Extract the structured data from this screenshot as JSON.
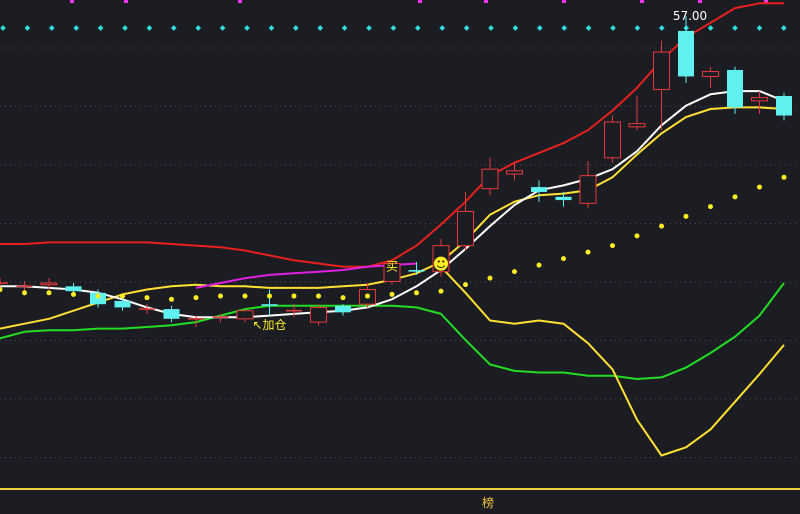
{
  "chart_data": {
    "type": "line",
    "subtype": "candlestick-with-indicators",
    "x_count": 33,
    "ylim": [
      28,
      58
    ],
    "grid": true,
    "legend": "none",
    "colors": {
      "background": "#1b1d22",
      "up_candle": "#e8393a",
      "down_candle": "#5ff0f0",
      "red_line": "#e8201e",
      "white_line": "#ffffff",
      "yellow_line": "#ffe033",
      "magenta_line": "#e020e0",
      "green_line": "#22dd22",
      "dots": "#ffee22",
      "cyan_dots": "#33dddd",
      "magenta_dots": "#ff33ff"
    },
    "candles": [
      {
        "o": 40.6,
        "c": 40.5,
        "h": 40.9,
        "l": 40.1,
        "d": "doji"
      },
      {
        "o": 40.4,
        "c": 40.4,
        "h": 40.7,
        "l": 40.1,
        "d": "doji"
      },
      {
        "o": 40.5,
        "c": 40.6,
        "h": 40.9,
        "l": 40.2,
        "d": "up"
      },
      {
        "o": 40.4,
        "c": 40.1,
        "h": 40.6,
        "l": 39.9,
        "d": "down"
      },
      {
        "o": 40.0,
        "c": 39.3,
        "h": 40.2,
        "l": 39.1,
        "d": "down"
      },
      {
        "o": 39.5,
        "c": 39.1,
        "h": 39.8,
        "l": 38.9,
        "d": "down"
      },
      {
        "o": 39.0,
        "c": 39.0,
        "h": 39.3,
        "l": 38.7,
        "d": "doji"
      },
      {
        "o": 39.0,
        "c": 38.4,
        "h": 39.2,
        "l": 38.2,
        "d": "down"
      },
      {
        "o": 38.4,
        "c": 38.4,
        "h": 38.6,
        "l": 37.9,
        "d": "doji"
      },
      {
        "o": 38.5,
        "c": 38.5,
        "h": 38.7,
        "l": 38.2,
        "d": "doji"
      },
      {
        "o": 38.4,
        "c": 38.9,
        "h": 39.0,
        "l": 38.2,
        "d": "up"
      },
      {
        "o": 39.2,
        "c": 39.3,
        "h": 40.2,
        "l": 38.6,
        "d": "down"
      },
      {
        "o": 38.9,
        "c": 38.9,
        "h": 39.3,
        "l": 38.5,
        "d": "doji"
      },
      {
        "o": 38.2,
        "c": 39.1,
        "h": 39.3,
        "l": 38.0,
        "d": "up"
      },
      {
        "o": 39.2,
        "c": 38.8,
        "h": 39.3,
        "l": 38.6,
        "d": "down"
      },
      {
        "o": 39.3,
        "c": 40.2,
        "h": 40.6,
        "l": 39.1,
        "d": "up"
      },
      {
        "o": 40.7,
        "c": 41.8,
        "h": 41.9,
        "l": 40.5,
        "d": "up"
      },
      {
        "o": 41.3,
        "c": 41.4,
        "h": 41.9,
        "l": 41.1,
        "d": "down"
      },
      {
        "o": 41.3,
        "c": 42.9,
        "h": 43.3,
        "l": 41.0,
        "d": "up"
      },
      {
        "o": 42.9,
        "c": 45.0,
        "h": 46.2,
        "l": 42.6,
        "d": "up"
      },
      {
        "o": 46.4,
        "c": 47.6,
        "h": 48.3,
        "l": 46.0,
        "d": "up"
      },
      {
        "o": 47.3,
        "c": 47.5,
        "h": 48.0,
        "l": 46.9,
        "d": "up"
      },
      {
        "o": 46.5,
        "c": 46.2,
        "h": 46.9,
        "l": 45.6,
        "d": "down"
      },
      {
        "o": 45.9,
        "c": 45.7,
        "h": 46.2,
        "l": 45.3,
        "d": "down"
      },
      {
        "o": 45.5,
        "c": 47.2,
        "h": 48.1,
        "l": 45.2,
        "d": "up"
      },
      {
        "o": 48.3,
        "c": 50.5,
        "h": 50.9,
        "l": 48.0,
        "d": "up"
      },
      {
        "o": 50.2,
        "c": 50.4,
        "h": 52.1,
        "l": 50.0,
        "d": "up"
      },
      {
        "o": 52.5,
        "c": 54.8,
        "h": 55.5,
        "l": 50.0,
        "d": "up"
      },
      {
        "o": 56.1,
        "c": 53.3,
        "h": 57.0,
        "l": 52.9,
        "d": "down"
      },
      {
        "o": 53.3,
        "c": 53.6,
        "h": 53.9,
        "l": 52.6,
        "d": "up"
      },
      {
        "o": 53.7,
        "c": 51.4,
        "h": 53.9,
        "l": 51.0,
        "d": "down"
      },
      {
        "o": 51.8,
        "c": 52.0,
        "h": 52.4,
        "l": 51.0,
        "d": "up"
      },
      {
        "o": 52.1,
        "c": 50.9,
        "h": 52.3,
        "l": 50.6,
        "d": "down"
      }
    ],
    "series": [
      {
        "values": [
          43.0,
          43.0,
          43.1,
          43.1,
          43.1,
          43.1,
          43.1,
          43.0,
          42.9,
          42.8,
          42.6,
          42.3,
          42.0,
          41.8,
          41.6,
          41.6,
          42.0,
          42.9,
          44.2,
          45.6,
          47.2,
          48.0,
          48.6,
          49.2,
          50.0,
          51.2,
          52.6,
          54.3,
          55.7,
          56.6,
          57.5,
          57.8,
          57.8
        ]
      },
      {
        "values": [
          40.4,
          40.4,
          40.3,
          40.2,
          40.0,
          39.6,
          39.1,
          38.7,
          38.5,
          38.5,
          38.5,
          38.6,
          38.7,
          38.8,
          38.9,
          39.1,
          39.6,
          40.4,
          41.4,
          42.7,
          44.1,
          45.4,
          46.3,
          46.6,
          47.0,
          47.6,
          48.7,
          50.3,
          51.5,
          52.2,
          52.4,
          52.4,
          51.8
        ]
      },
      {
        "values": [
          37.8,
          38.1,
          38.4,
          38.9,
          39.4,
          39.9,
          40.2,
          40.4,
          40.5,
          40.4,
          40.4,
          40.3,
          40.3,
          40.3,
          40.4,
          40.5,
          40.8,
          41.2,
          41.9,
          43.2,
          44.8,
          45.6,
          46.0,
          46.1,
          46.3,
          47.1,
          48.5,
          49.8,
          50.8,
          51.3,
          51.4,
          51.4,
          51.3
        ]
      },
      {
        "values": [
          null,
          null,
          null,
          null,
          null,
          null,
          null,
          null,
          40.3,
          40.6,
          40.9,
          41.1,
          41.2,
          41.3,
          41.4,
          41.6,
          41.7,
          41.8
        ]
      },
      {
        "values": [
          37.2,
          37.6,
          37.7,
          37.7,
          37.8,
          37.8,
          37.9,
          38.0,
          38.2,
          38.6,
          39.0,
          39.2,
          39.2,
          39.2,
          39.2,
          39.2,
          39.2,
          39.1,
          38.7,
          37.1,
          35.6,
          35.2,
          35.1,
          35.1,
          34.9,
          34.9,
          34.7,
          34.8,
          35.4,
          36.3,
          37.3,
          38.6,
          40.6
        ]
      },
      {
        "values": [
          null,
          null,
          null,
          null,
          null,
          null,
          null,
          null,
          null,
          null,
          null,
          null,
          null,
          null,
          null,
          null,
          null,
          null,
          41.6,
          40.0,
          38.3,
          38.1,
          38.3,
          38.1,
          36.9,
          35.3,
          32.2,
          30.0,
          30.5,
          31.6,
          33.3,
          35.0,
          36.8
        ]
      },
      {
        "values": [
          40.2,
          40.0,
          40.0,
          39.9,
          39.8,
          39.8,
          39.7,
          39.6,
          39.7,
          39.8,
          39.8,
          39.8,
          39.8,
          39.8,
          39.7,
          39.8,
          39.9,
          40.0,
          40.1,
          40.5,
          40.9,
          41.3,
          41.7,
          42.1,
          42.5,
          42.9,
          43.5,
          44.1,
          44.7,
          45.3,
          45.9,
          46.5,
          47.1
        ]
      }
    ],
    "annotations": [
      {
        "text": "57.00",
        "x": 28,
        "y": 57.0
      },
      {
        "text": "↖加仓",
        "x": 11,
        "y": 38.0
      },
      {
        "text": "买",
        "x": 16,
        "y": 41.6
      },
      {
        "text": "☻",
        "x": 18,
        "y": 41.7
      }
    ]
  },
  "footer": {
    "label": "榜"
  }
}
